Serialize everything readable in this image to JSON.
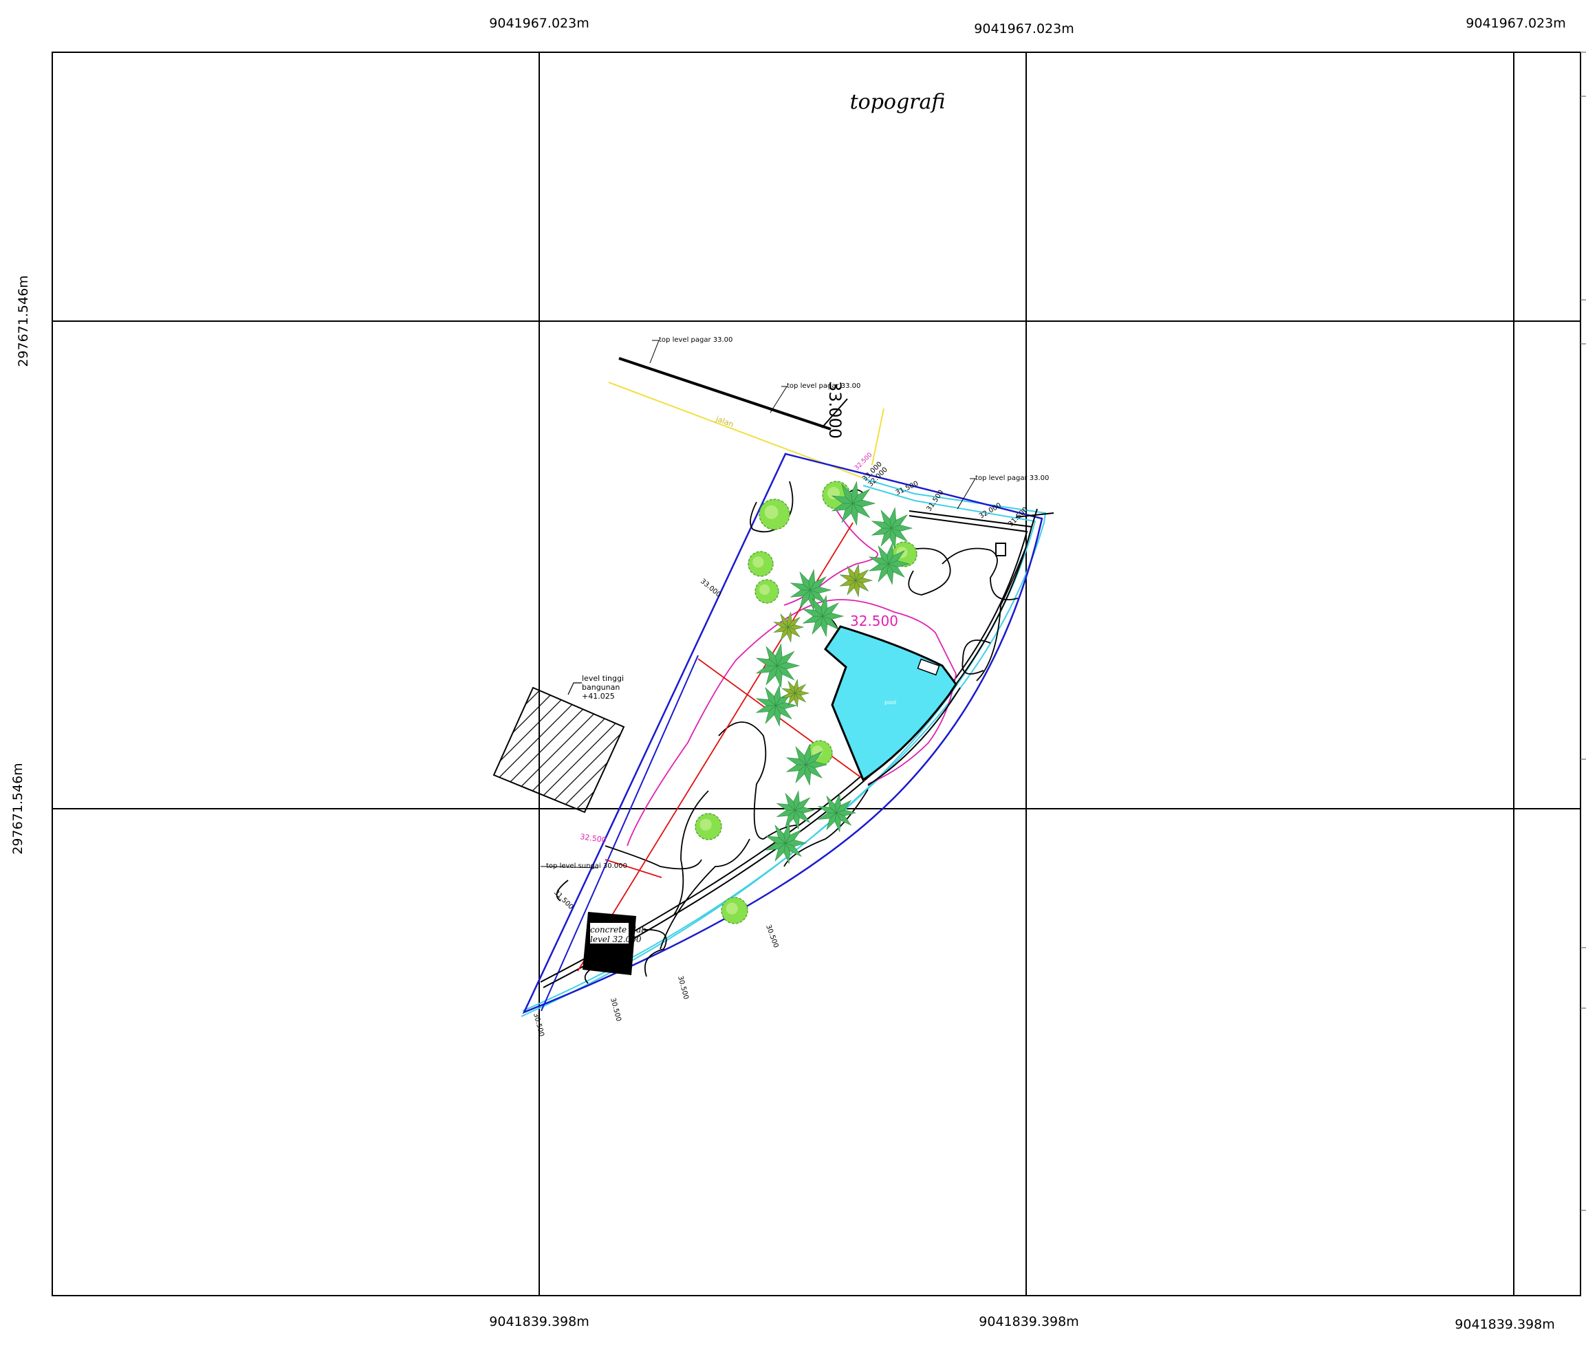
{
  "title": "topografi",
  "coords": {
    "top": [
      "9041967.023m",
      "9041967.023m",
      "9041967.023m"
    ],
    "bottom": [
      "9041839.398m",
      "9041839.398m",
      "9041839.398m"
    ],
    "left": [
      "297671.546m",
      "297671.546m"
    ]
  },
  "levels": {
    "large_top": "33.000",
    "pink_main": "32.500",
    "pink_left": "32.500",
    "pink_small": "32.500",
    "l33_left": "33.000",
    "l31_5_left": "31.500",
    "top_small_a": "33.000",
    "top_small_b": "32.000",
    "top_small_c": "31.500",
    "right_a": "31.500",
    "right_b": "32.000",
    "right_c": "31.500",
    "bottom_a": "30.500",
    "bottom_b": "30.500",
    "bottom_c": "30.500",
    "bottom_d": "30.500"
  },
  "road_label": "jalan",
  "pool_label": "pool",
  "building_note": {
    "line1": "level tinggi",
    "line2": "bangunan",
    "line3": "+41.025"
  },
  "slab": {
    "line1": "concrete slab",
    "line2": "level 32.000"
  },
  "tiny_labels": {
    "fence_a": "top level pagar 33.00",
    "fence_b": "top level pagar 33.00",
    "fence_c": "top level pagar 33.00",
    "fence_d": "top level sungai 30.000"
  },
  "colors": {
    "boundary": "#1a1ad0",
    "contour_pink": "#e020b0",
    "axis_red": "#e01010",
    "road_yellow": "#f0e040",
    "river_cyan": "#40d0e8",
    "pool_fill": "#58e4f4",
    "palm_green": "#4cba62",
    "bush_green": "#88e04c",
    "olive_green": "#98b02c"
  }
}
